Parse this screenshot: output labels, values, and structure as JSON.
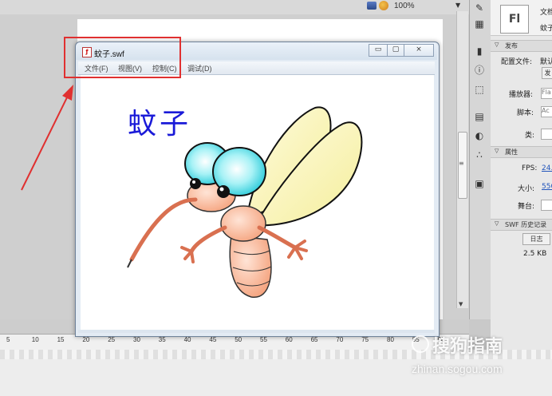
{
  "toolbar": {
    "zoom": "100%"
  },
  "ruler": {
    "ticks": [
      "5",
      "10",
      "15",
      "20",
      "25",
      "30",
      "35",
      "40",
      "45",
      "50",
      "55",
      "60",
      "65",
      "70",
      "75",
      "80",
      "85",
      "90"
    ]
  },
  "tools_panel": {
    "icons": [
      "brush-tool-icon",
      "component-icon",
      "align-icon",
      "info-icon",
      "transform-icon",
      "history-icon",
      "color-icon",
      "swatches-icon",
      "library-icon"
    ]
  },
  "properties": {
    "logo": "Fl",
    "doc_label": "文档",
    "doc_name": "蚊子",
    "section_publish": "发布",
    "profile_label": "配置文件:",
    "profile_value": "默认",
    "publish_btn": "发",
    "player_label": "播放器:",
    "player_value": "Fla",
    "script_label": "脚本:",
    "script_value": "Ac",
    "class_label": "类:",
    "section_properties": "属性",
    "fps_label": "FPS:",
    "fps_value": "24.",
    "size_label": "大小:",
    "size_value": "550",
    "stage_label": "舞台:",
    "section_history": "SWF 历史记录",
    "log_btn": "日志",
    "file_size": "2.5 KB"
  },
  "swf_window": {
    "title": "蚊子.swf",
    "menus": [
      "文件(F)",
      "视图(V)",
      "控制(C)",
      "调试(D)"
    ],
    "min_btn": "▭",
    "max_btn": "▢",
    "close_btn": "⨯",
    "content_title": "蚊子"
  },
  "watermark": {
    "brand": "搜狗指南",
    "url": "zhinan.sogou.com"
  },
  "colors": {
    "annotation": "#e03030",
    "title_text": "#1a1ad8"
  }
}
